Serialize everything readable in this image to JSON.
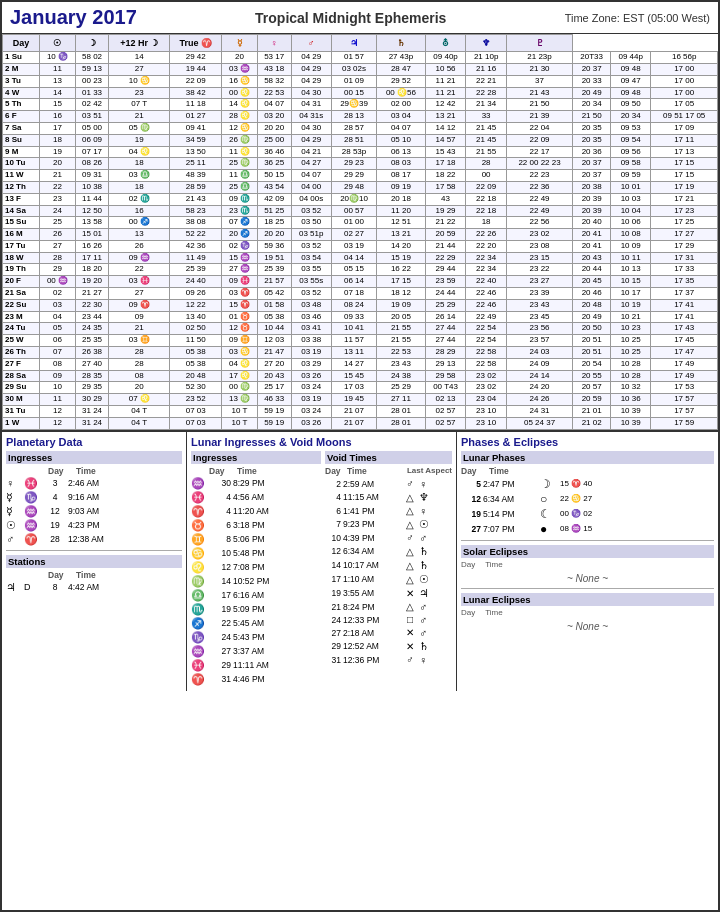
{
  "header": {
    "title": "January 2017",
    "subtitle": "Tropical Midnight Ephemeris",
    "timezone": "Time Zone: EST  (05:00 West)"
  },
  "table": {
    "columns": [
      "Day",
      "☉",
      "☽",
      "+12 Hr ☽",
      "True ♈",
      "☿",
      "♀",
      "♂",
      "♃",
      "♄",
      "⛢",
      "♆",
      "♇"
    ],
    "rows": [
      [
        "1 Su",
        "10",
        "58 02",
        "14",
        "29 42",
        "20",
        "53 17",
        "04",
        "29",
        "01 57",
        "27",
        "43p",
        "09",
        "40p",
        "21",
        "10p",
        "21",
        "23p",
        "20 T",
        "33 0",
        "09",
        "44p",
        "16",
        "56p"
      ],
      [
        "2 M",
        "11",
        "59 13",
        "27",
        "19 44",
        "03",
        "43 18",
        "04",
        "29",
        "03 02s",
        "28",
        "47",
        "10",
        "56",
        "21",
        "16",
        "21",
        "30",
        "20",
        "37",
        "09",
        "48",
        "17",
        "00"
      ],
      [
        "3 Tu",
        "13",
        "00 23",
        "10 ♋",
        "22 09",
        "16",
        "58 32",
        "04",
        "29",
        "01 09",
        "29",
        "52",
        "11",
        "21",
        "22",
        "21",
        "37",
        "20",
        "33",
        "09",
        "47",
        "17",
        "00"
      ],
      [
        "4 W",
        "14",
        "01 33",
        "23",
        "38 42",
        "00 ♌",
        "22 53",
        "04",
        "30",
        "00 15",
        "00 ♌",
        "56",
        "11",
        "21",
        "22",
        "28",
        "21",
        "43",
        "20",
        "49",
        "09",
        "48",
        "17",
        "00"
      ],
      [
        "5 Th",
        "15",
        "02 42",
        "07 T",
        "11 18",
        "14",
        "04 07",
        "04",
        "31",
        "29 ♋",
        "39",
        "02",
        "00",
        "12",
        "42",
        "21",
        "34",
        "21",
        "50",
        "20",
        "34",
        "09",
        "50",
        "17",
        "05"
      ],
      [
        "6 F",
        "16",
        "03 51",
        "21",
        "01 27",
        "28",
        "03 20",
        "04",
        "31s",
        "28",
        "13",
        "03",
        "04",
        "13",
        "21",
        "33",
        "21",
        "39",
        "21",
        "50",
        "20",
        "34",
        "09",
        "51",
        "17",
        "05"
      ],
      [
        "7 Sa",
        "17",
        "05 00",
        "05",
        "09 41",
        "12 ♋",
        "20 20",
        "04",
        "30",
        "28",
        "57",
        "04",
        "07",
        "14",
        "12",
        "21",
        "45",
        "22",
        "04",
        "20",
        "35",
        "09",
        "53",
        "17",
        "09"
      ],
      [
        "8 Su",
        "18",
        "06 09",
        "19",
        "34 59",
        "26",
        "25 00",
        "04",
        "29",
        "28",
        "51",
        "05",
        "10",
        "14",
        "57",
        "21",
        "45",
        "22",
        "09",
        "20",
        "35",
        "09",
        "54",
        "17",
        "11"
      ],
      [
        "9 M",
        "19",
        "07 17",
        "04 ♌",
        "13 50",
        "11 ♌",
        "36 46",
        "04",
        "21",
        "28",
        "53p",
        "06",
        "13",
        "15",
        "43",
        "21",
        "55",
        "22",
        "17",
        "20",
        "36",
        "09",
        "56",
        "17",
        "13"
      ],
      [
        "10 Tu",
        "20",
        "08 26",
        "18",
        "25 11",
        "11 ♌",
        "36 25",
        "04",
        "27",
        "29",
        "23",
        "08",
        "03",
        "17",
        "18",
        "28",
        "22",
        "00",
        "22",
        "23",
        "20",
        "37",
        "09",
        "58",
        "17",
        "15"
      ],
      [
        "11 W",
        "21",
        "09 31",
        "03 ♍",
        "48 39",
        "11",
        "50 15",
        "04",
        "07",
        "29",
        "29",
        "08",
        "17",
        "18",
        "22",
        "00",
        "22",
        "23",
        "20",
        "37",
        "09",
        "59",
        "17",
        "15"
      ],
      [
        "12 Th",
        "22",
        "10 38",
        "18",
        "28 59",
        "25",
        "43 54",
        "04",
        "00",
        "29",
        "48",
        "09",
        "19",
        "17",
        "58",
        "22",
        "09",
        "22",
        "36",
        "20",
        "38",
        "10",
        "01",
        "17",
        "19"
      ],
      [
        "13 F",
        "23",
        "11 44",
        "02 ♎",
        "21 43",
        "09 ♎",
        "42 09",
        "04",
        "00s",
        "20 ♍",
        "10",
        "20",
        "18",
        "43",
        "22",
        "18",
        "22",
        "49",
        "20",
        "39",
        "10",
        "03",
        "17",
        "21"
      ],
      [
        "14 Sa",
        "24",
        "12 50",
        "16",
        "58 23",
        "23",
        "51 25",
        "03",
        "52",
        "00",
        "57",
        "11",
        "20",
        "19",
        "29",
        "22",
        "18",
        "22",
        "49",
        "20",
        "39",
        "10",
        "04",
        "17",
        "23"
      ],
      [
        "15 Su",
        "25",
        "13 58",
        "00 ♏",
        "38 08",
        "07 ♏",
        "18 25",
        "03",
        "50",
        "01",
        "00",
        "12",
        "51",
        "21",
        "22",
        "18",
        "22",
        "56",
        "20",
        "40",
        "10",
        "06",
        "17",
        "25"
      ],
      [
        "16 M",
        "26",
        "15 01",
        "13",
        "52 22",
        "20",
        "20 20",
        "03",
        "51p",
        "02",
        "27",
        "13",
        "21",
        "20",
        "59",
        "22",
        "26",
        "23",
        "02",
        "20",
        "41",
        "10",
        "08",
        "17",
        "27"
      ],
      [
        "17 Tu",
        "27",
        "16 26",
        "26",
        "42 36",
        "02 ♐",
        "59 36",
        "03",
        "52",
        "03",
        "19",
        "14",
        "20",
        "21",
        "44",
        "22",
        "20",
        "23",
        "08",
        "20",
        "41",
        "10",
        "09",
        "17",
        "29"
      ],
      [
        "18 W",
        "28",
        "17 11",
        "09 ♑",
        "11 49",
        "15",
        "19 51",
        "03",
        "54",
        "04",
        "14",
        "15",
        "19",
        "22",
        "29",
        "22",
        "34",
        "23",
        "15",
        "20",
        "43",
        "10",
        "11",
        "17",
        "31"
      ],
      [
        "19 Th",
        "29",
        "18 20",
        "22",
        "25 39",
        "27",
        "25 39",
        "03",
        "55",
        "05",
        "15",
        "16",
        "22",
        "29",
        "44",
        "22",
        "34",
        "23",
        "22",
        "20",
        "44",
        "10",
        "13",
        "17",
        "33"
      ],
      [
        "20 F",
        "00 ♒",
        "19 20",
        "03 ♒",
        "24 40",
        "09 ♒",
        "21 57",
        "03",
        "55s",
        "06",
        "14",
        "17",
        "15",
        "23",
        "59",
        "22",
        "40",
        "23",
        "27",
        "20",
        "45",
        "10",
        "15",
        "17",
        "35"
      ],
      [
        "21 Sa",
        "02",
        "21 27",
        "27",
        "09 26",
        "03 ♓",
        "05 42",
        "03",
        "52",
        "07",
        "18",
        "18",
        "12",
        "24",
        "44",
        "22",
        "46",
        "23",
        "39",
        "20",
        "46",
        "10",
        "17",
        "17",
        "37"
      ],
      [
        "22 Su",
        "03",
        "22 30",
        "09 ♓",
        "12 22",
        "15",
        "01 58",
        "03",
        "48",
        "08",
        "24",
        "19",
        "09",
        "25",
        "29",
        "22",
        "46",
        "23",
        "43",
        "20",
        "48",
        "10",
        "19",
        "17",
        "41"
      ],
      [
        "23 M",
        "04",
        "23 44",
        "09",
        "13 40",
        "01 ♈",
        "05 38",
        "03",
        "46",
        "09",
        "33",
        "20",
        "05",
        "26",
        "14",
        "22",
        "49",
        "23",
        "45",
        "20",
        "49",
        "10",
        "21",
        "17",
        "41"
      ],
      [
        "24 Tu",
        "05",
        "24 35",
        "21",
        "02 50",
        "12",
        "10 44",
        "03",
        "41",
        "10",
        "41",
        "21",
        "55",
        "27",
        "44",
        "22",
        "54",
        "23",
        "56",
        "20",
        "50",
        "10",
        "23",
        "17",
        "43"
      ],
      [
        "25 W",
        "06",
        "25 35",
        "03 T",
        "11 50",
        "09 T",
        "12 03",
        "03",
        "38",
        "11",
        "57",
        "21",
        "55",
        "27",
        "44",
        "22",
        "54",
        "23",
        "57",
        "20",
        "51",
        "10",
        "25",
        "17",
        "45"
      ],
      [
        "26 Th",
        "07",
        "26 38",
        "28",
        "05 38",
        "03",
        "21 47",
        "03",
        "19",
        "13",
        "11",
        "22",
        "53",
        "28",
        "29",
        "22",
        "58",
        "24",
        "03",
        "20",
        "51",
        "10",
        "25",
        "17",
        "47"
      ],
      [
        "27 F",
        "08",
        "27 40",
        "28",
        "05 38",
        "04 ♌",
        "27 20",
        "03",
        "29",
        "14",
        "27",
        "23",
        "43",
        "29",
        "13",
        "22",
        "58",
        "24",
        "09",
        "20",
        "54",
        "10",
        "28",
        "17",
        "49"
      ],
      [
        "28 Sa",
        "09",
        "28 35",
        "08",
        "20 48",
        "17",
        "20 43",
        "03",
        "26",
        "15",
        "45",
        "24",
        "38",
        "29",
        "58",
        "23",
        "02",
        "24",
        "14",
        "20",
        "55",
        "10",
        "28",
        "17",
        "49"
      ],
      [
        "29 Su",
        "10",
        "29 35",
        "20",
        "52 30",
        "00 ♍",
        "25 17",
        "03",
        "24",
        "17",
        "03",
        "25",
        "29",
        "00 T",
        "43",
        "23",
        "02",
        "24",
        "20",
        "20",
        "57",
        "10",
        "32",
        "17",
        "53"
      ],
      [
        "30 M",
        "11",
        "30 29",
        "07 ♌",
        "23 52",
        "13",
        "46 33",
        "03",
        "19",
        "19",
        "45",
        "27",
        "11",
        "02",
        "13",
        "23",
        "04",
        "24",
        "26",
        "20",
        "59",
        "10",
        "36",
        "17",
        "57"
      ],
      [
        "31 Tu",
        "12",
        "31 24",
        "04 T",
        "07 03",
        "10 T",
        "59 19",
        "03",
        "24",
        "21",
        "07",
        "28",
        "01",
        "02",
        "57",
        "23",
        "10",
        "24",
        "31",
        "21",
        "01",
        "10",
        "39",
        "17",
        "57"
      ],
      [
        "1 W",
        "12",
        "31 24",
        "04 T",
        "07 03",
        "10 T",
        "59 19",
        "03",
        "26",
        "21",
        "07",
        "28",
        "01",
        "02",
        "57",
        "23",
        "10",
        "05",
        "24",
        "37",
        "21",
        "02",
        "10",
        "39",
        "17",
        "59"
      ]
    ]
  },
  "planetary_data": {
    "title": "Planetary Data",
    "ingresses_title": "Ingresses",
    "col_headers": [
      "Day",
      "Time"
    ],
    "ingresses": [
      {
        "planet": "♀",
        "sign": "♓",
        "day": "3",
        "time": "2:46 AM"
      },
      {
        "planet": "☿",
        "sign": "♑",
        "day": "4",
        "time": "9:16 AM"
      },
      {
        "planet": "☿",
        "sign": "♒",
        "day": "12",
        "time": "9:03 AM"
      },
      {
        "planet": "☉",
        "sign": "♒",
        "day": "19",
        "time": "4:23 PM"
      },
      {
        "planet": "♂",
        "sign": "♈",
        "day": "28",
        "time": "12:38 AM"
      }
    ],
    "stations_title": "Stations",
    "stations": [
      {
        "planet": "♃",
        "dir": "D",
        "day": "8",
        "time": "4:42 AM"
      }
    ]
  },
  "lunar_ingresses": {
    "title": "Lunar Ingresses & Void Moons",
    "ingresses_title": "Ingresses",
    "col_headers": [
      "Day",
      "Time"
    ],
    "ingresses": [
      {
        "sign": "♒",
        "day": "30",
        "time": "8:29 PM"
      },
      {
        "sign": "♓",
        "day": "4",
        "time": "4:56 AM"
      },
      {
        "sign": "♈",
        "day": "4",
        "time": "11:20 AM"
      },
      {
        "sign": "♉",
        "day": "6",
        "time": "3:18 PM"
      },
      {
        "sign": "♊",
        "day": "8",
        "time": "5:06 PM"
      },
      {
        "sign": "♋",
        "day": "10",
        "time": "5:48 PM"
      },
      {
        "sign": "♌",
        "day": "12",
        "time": "7:08 PM"
      },
      {
        "sign": "♍",
        "day": "14",
        "time": "10:52 PM"
      },
      {
        "sign": "♎",
        "day": "17",
        "time": "6:16 AM"
      },
      {
        "sign": "♏",
        "day": "19",
        "time": "5:09 PM"
      },
      {
        "sign": "♐",
        "day": "22",
        "time": "5:45 AM"
      },
      {
        "sign": "♑",
        "day": "24",
        "time": "5:43 PM"
      },
      {
        "sign": "♒",
        "day": "27",
        "time": "3:37 AM"
      },
      {
        "sign": "♓",
        "day": "29",
        "time": "11:11 AM"
      },
      {
        "sign": "♈",
        "day": "31",
        "time": "4:46 PM"
      }
    ],
    "void_title": "Void Times",
    "last_aspect": "Last Aspect",
    "void_times": [
      {
        "day": "2",
        "time": "2:59 AM",
        "aspect": "♂",
        "planet": "♀"
      },
      {
        "day": "4",
        "time": "11:15 AM",
        "aspect": "△",
        "planet": "♆"
      },
      {
        "day": "6",
        "time": "1:41 PM",
        "aspect": "△",
        "planet": "♀"
      },
      {
        "day": "7",
        "time": "9:23 PM",
        "aspect": "△",
        "planet": "☉"
      },
      {
        "day": "10",
        "time": "4:39 PM",
        "aspect": "♂",
        "planet": "♂"
      },
      {
        "day": "12",
        "time": "6:34 AM",
        "aspect": "△",
        "planet": "♄"
      },
      {
        "day": "14",
        "time": "10:17 AM",
        "aspect": "△",
        "planet": "♄"
      },
      {
        "day": "17",
        "time": "1:10 AM",
        "aspect": "△",
        "planet": "☉"
      },
      {
        "day": "19",
        "time": "3:55 AM",
        "aspect": "✕",
        "planet": "♃"
      },
      {
        "day": "21",
        "time": "8:24 PM",
        "aspect": "△",
        "planet": "♂"
      },
      {
        "day": "24",
        "time": "12:33 PM",
        "aspect": "□",
        "planet": "♂"
      },
      {
        "day": "27",
        "time": "2:18 AM",
        "aspect": "✕",
        "planet": "♂"
      },
      {
        "day": "29",
        "time": "12:52 AM",
        "aspect": "✕",
        "planet": "♄"
      },
      {
        "day": "31",
        "time": "12:36 PM",
        "aspect": "♂",
        "planet": "♀"
      }
    ]
  },
  "phases_eclipses": {
    "title": "Phases & Eclipses",
    "lunar_phases_title": "Lunar Phases",
    "col_headers": [
      "Day",
      "Time"
    ],
    "phases": [
      {
        "day": "5",
        "time": "2:47 PM",
        "symbol": "☽",
        "value": "15 ♈ 40"
      },
      {
        "day": "12",
        "time": "6:34 AM",
        "symbol": "○",
        "value": "22 ♋ 27"
      },
      {
        "day": "19",
        "time": "5:14 PM",
        "symbol": "☾",
        "value": "00 ♑ 02"
      },
      {
        "day": "27",
        "time": "7:07 PM",
        "symbol": "●",
        "value": "08 ♒ 15"
      }
    ],
    "solar_eclipses_title": "Solar Eclipses",
    "solar_eclipses_col": [
      "Day",
      "Time"
    ],
    "solar_none": "~ None ~",
    "lunar_eclipses_title": "Lunar Eclipses",
    "lunar_eclipses_col": [
      "Day",
      "Time"
    ],
    "lunar_none": "~ None ~"
  }
}
